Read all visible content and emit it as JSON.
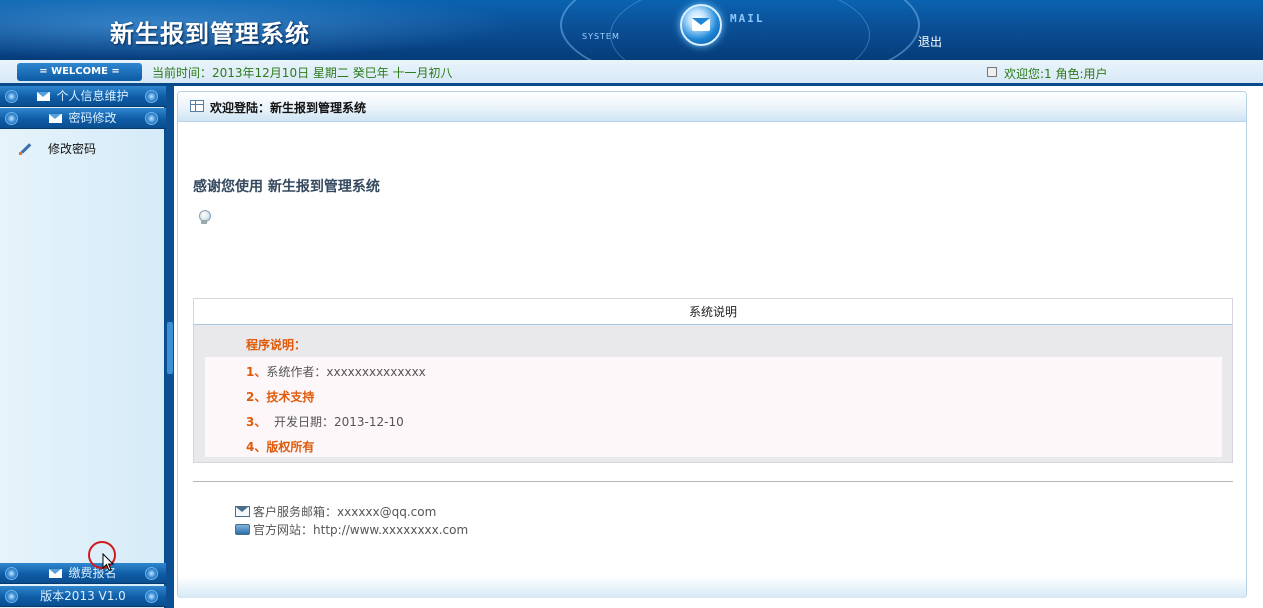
{
  "header": {
    "title": "新生报到管理系统",
    "system_tag": "SYSTEM",
    "mail_tag": "MAIL",
    "logout": "退出",
    "brand_color": "#0b4f96"
  },
  "infobar": {
    "welcome": "= WELCOME =",
    "current_time": "当前时间：2013年12月10日 星期二 癸巳年 十一月初八",
    "user_info": "欢迎您:1 角色:用户"
  },
  "sidebar": {
    "menus": [
      {
        "label": "个人信息维护"
      },
      {
        "label": "密码修改"
      }
    ],
    "sub_items": [
      {
        "label": "修改密码"
      }
    ],
    "bottom_menus": [
      {
        "label": "缴费报名"
      },
      {
        "label": "版本2013 V1.0"
      }
    ]
  },
  "main": {
    "panel_title": "欢迎登陆：新生报到管理系统",
    "thanks": "感谢您使用 新生报到管理系统",
    "desc_header": "系统说明",
    "program_title": "程序说明：",
    "items": [
      {
        "num": "1、",
        "text": "系统作者：xxxxxxxxxxxxxx"
      },
      {
        "num": "2、",
        "text": "技术支持"
      },
      {
        "num": "3、",
        "text": "  开发日期：2013-12-10"
      },
      {
        "num": "4、",
        "text": "版权所有"
      }
    ],
    "contact": {
      "email_label": "客户服务邮箱：",
      "email": "xxxxxx@qq.com",
      "site_label": "官方网站：",
      "site": "http://www.xxxxxxxx.com"
    }
  }
}
